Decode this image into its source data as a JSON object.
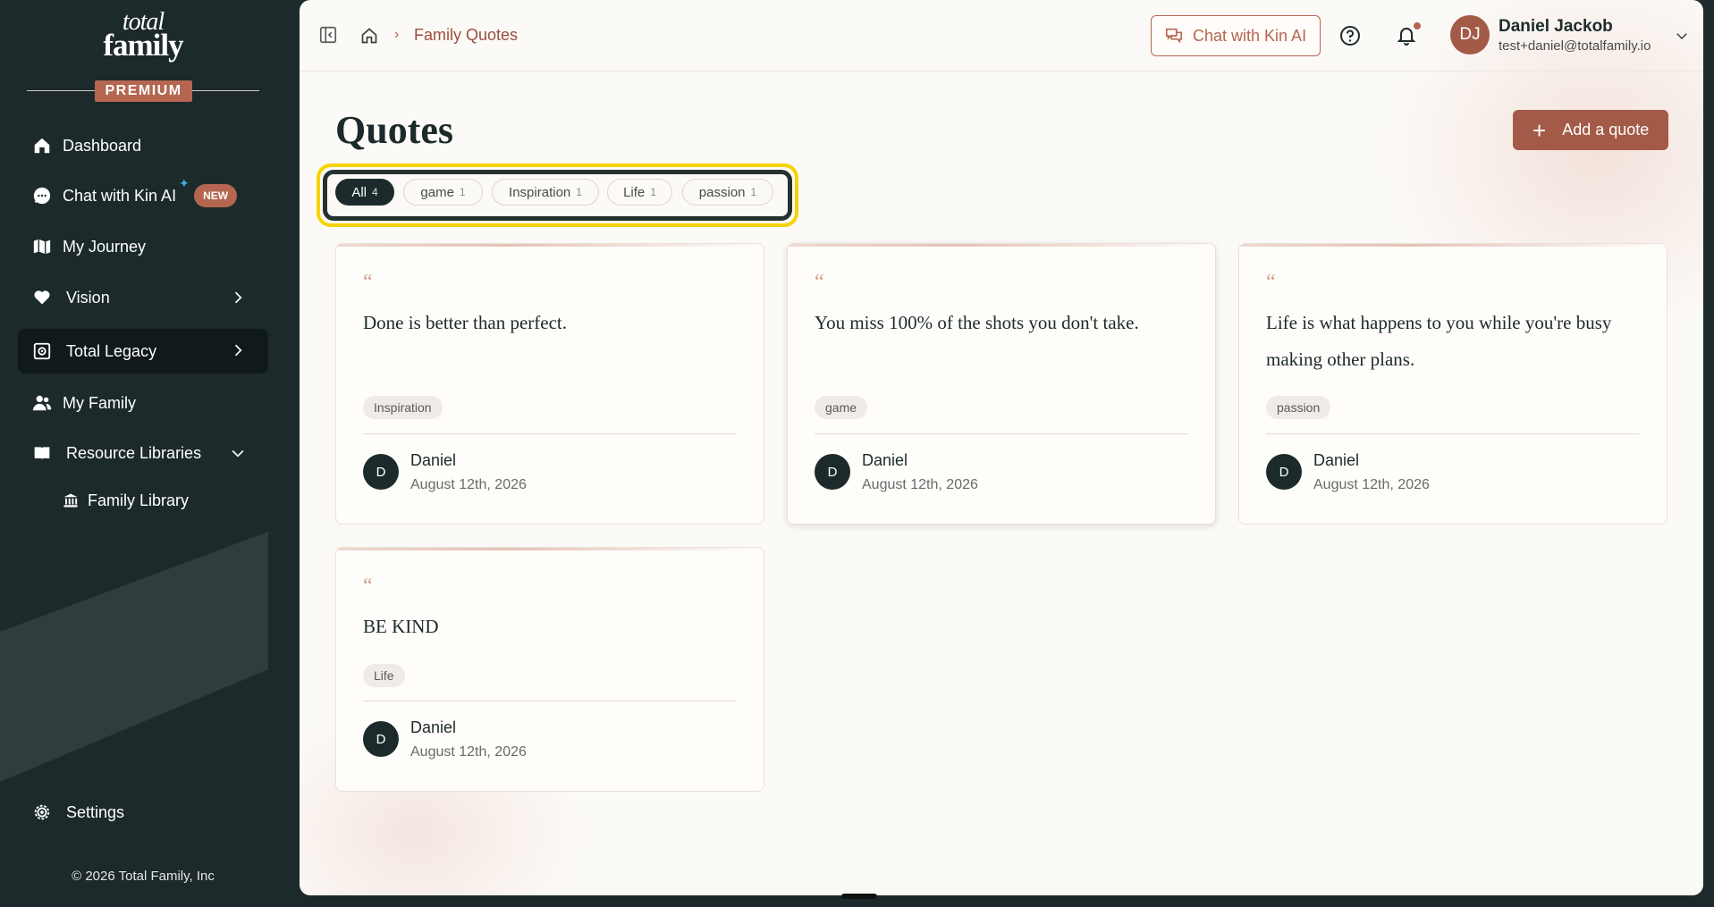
{
  "sidebar": {
    "logo_line1": "total",
    "logo_line2": "family",
    "premium": "PREMIUM",
    "items": [
      {
        "label": "Dashboard",
        "icon": "home-icon"
      },
      {
        "label": "Chat with Kin AI",
        "icon": "chat-bubble-icon",
        "badge": "NEW"
      },
      {
        "label": "My Journey",
        "icon": "map-icon"
      },
      {
        "label": "Vision",
        "icon": "heart-icon"
      },
      {
        "label": "Total Legacy",
        "icon": "safe-icon"
      },
      {
        "label": "My Family",
        "icon": "users-icon"
      },
      {
        "label": "Resource Libraries",
        "icon": "book-icon"
      }
    ],
    "sub_items": [
      {
        "label": "Family Library",
        "icon": "bank-icon"
      }
    ],
    "settings": "Settings",
    "copyright": "© 2026 Total Family, Inc"
  },
  "topbar": {
    "breadcrumb": "Family Quotes",
    "chat_button": "Chat with Kin AI",
    "user": {
      "initials": "DJ",
      "name": "Daniel Jackob",
      "email": "test+daniel@totalfamily.io"
    }
  },
  "page": {
    "title": "Quotes",
    "add_button": "Add a quote"
  },
  "filters": [
    {
      "label": "All",
      "count": "4",
      "active": true
    },
    {
      "label": "game",
      "count": "1"
    },
    {
      "label": "Inspiration",
      "count": "1"
    },
    {
      "label": "Life",
      "count": "1"
    },
    {
      "label": "passion",
      "count": "1"
    }
  ],
  "quotes": [
    {
      "mark": "“",
      "text": "Done is better than perfect.",
      "tag": "Inspiration",
      "author_initial": "D",
      "author": "Daniel",
      "date": "August 12th, 2026"
    },
    {
      "mark": "“",
      "text": "You miss 100% of the shots you don't take.",
      "tag": "game",
      "author_initial": "D",
      "author": "Daniel",
      "date": "August 12th, 2026"
    },
    {
      "mark": "“",
      "text": "Life is what happens to you while you're busy making other plans.",
      "tag": "passion",
      "author_initial": "D",
      "author": "Daniel",
      "date": "August 12th, 2026"
    },
    {
      "mark": "“",
      "text": "BE KIND",
      "tag": "Life",
      "author_initial": "D",
      "author": "Daniel",
      "date": "August 12th, 2026"
    }
  ],
  "colors": {
    "sidebar_bg": "#1c2a2b",
    "accent": "#b46650",
    "highlight": "#f5d300"
  }
}
